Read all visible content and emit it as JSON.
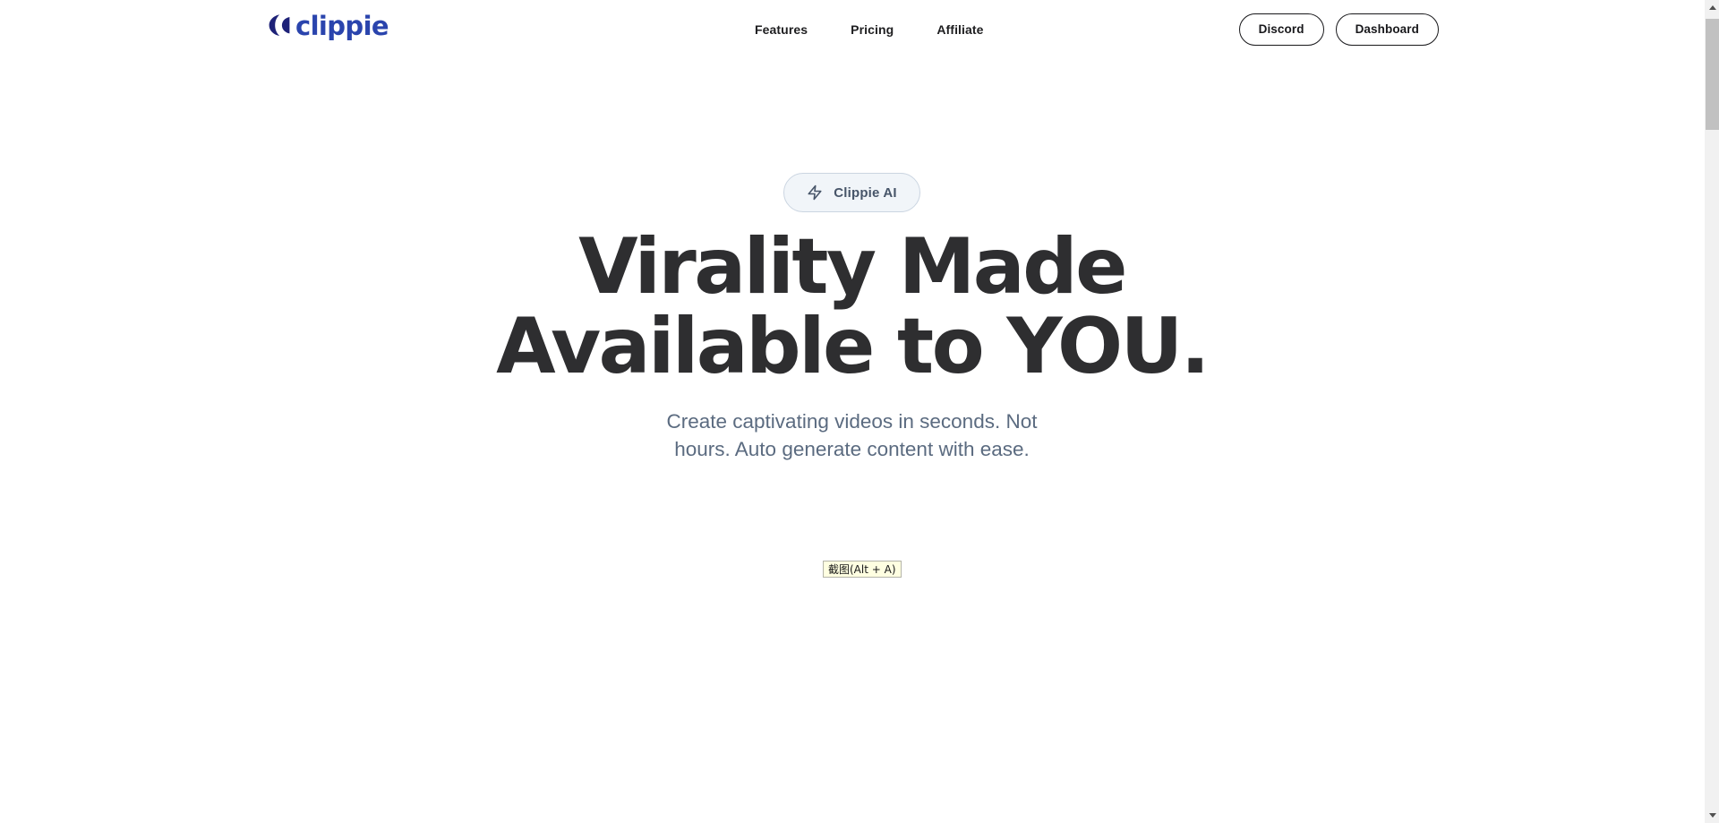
{
  "header": {
    "brand": {
      "mark_icon": "clippie-logo-mark",
      "wordmark": "clippie",
      "mark_color": "#1e2278",
      "word_color": "#2a44ad"
    },
    "nav": [
      {
        "label": "Features"
      },
      {
        "label": "Pricing"
      },
      {
        "label": "Affiliate"
      }
    ],
    "actions": [
      {
        "label": "Discord"
      },
      {
        "label": "Dashboard"
      }
    ]
  },
  "hero": {
    "badge": {
      "icon": "zap-icon",
      "label": "Clippie AI",
      "bg_color": "#f1f5f9",
      "border_color": "#cbd5e1",
      "text_color": "#475569"
    },
    "title_line_1": "Virality Made",
    "title_line_2": "Available to YOU.",
    "title_color": "#2e2e30",
    "subtitle_line_1": "Create captivating videos in seconds. Not",
    "subtitle_line_2": "hours. Auto generate content with ease.",
    "subtitle_color": "#5b6b80"
  },
  "overlay": {
    "capture_tooltip": "截图(Alt + A)",
    "tooltip_bg": "#ffffe1",
    "tooltip_border": "#b4b4a8"
  },
  "scrollbar": {
    "up_arrow_icon": "scroll-up-arrow-icon",
    "down_arrow_icon": "scroll-down-arrow-icon",
    "track_color": "#f1f1f1",
    "thumb_color": "#c1c1c1"
  }
}
